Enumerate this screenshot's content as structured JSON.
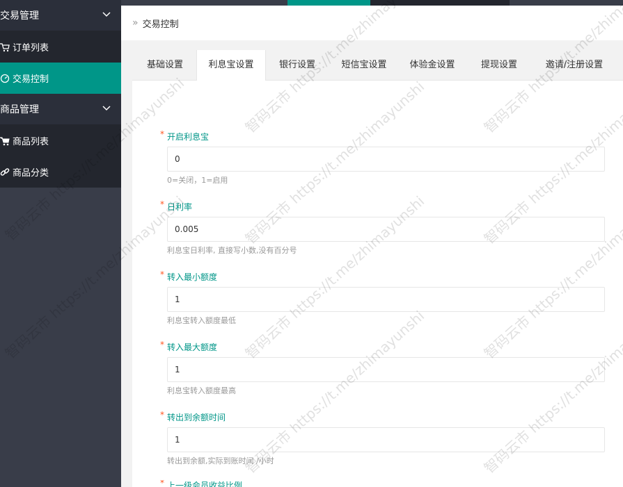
{
  "sidebar": {
    "groups": [
      {
        "label": "交易管理",
        "items": [
          {
            "label": "订单列表",
            "icon": "cart-icon"
          },
          {
            "label": "交易控制",
            "icon": "gauge-icon",
            "active": true
          }
        ]
      },
      {
        "label": "商品管理",
        "items": [
          {
            "label": "商品列表",
            "icon": "cart-icon"
          },
          {
            "label": "商品分类",
            "icon": "link-icon"
          }
        ]
      }
    ]
  },
  "header": {
    "title": "交易控制"
  },
  "tabs": [
    {
      "label": "基础设置"
    },
    {
      "label": "利息宝设置",
      "active": true
    },
    {
      "label": "银行设置"
    },
    {
      "label": "短信宝设置"
    },
    {
      "label": "体验金设置"
    },
    {
      "label": "提现设置"
    },
    {
      "label": "邀请/注册设置"
    }
  ],
  "form": {
    "fields": [
      {
        "label": "开启利息宝",
        "value": "0",
        "help": "0=关闭，1=启用"
      },
      {
        "label": "日利率",
        "value": "0.005",
        "help": "利息宝日利率, 直接写小数,没有百分号"
      },
      {
        "label": "转入最小额度",
        "value": "1",
        "help": "利息宝转入额度最低"
      },
      {
        "label": "转入最大额度",
        "value": "1",
        "help": "利息宝转入额度最高"
      },
      {
        "label": "转出到余额时间",
        "value": "1",
        "help": "转出到余额,实际到账时间 /小时"
      },
      {
        "label": "上一级会员收益比例"
      }
    ]
  },
  "watermark": {
    "text": "智码云市 https://t.me/zhimayunshi"
  },
  "colors": {
    "accent": "#009688",
    "sidebar": "#393D49",
    "required": "#FF5722"
  }
}
